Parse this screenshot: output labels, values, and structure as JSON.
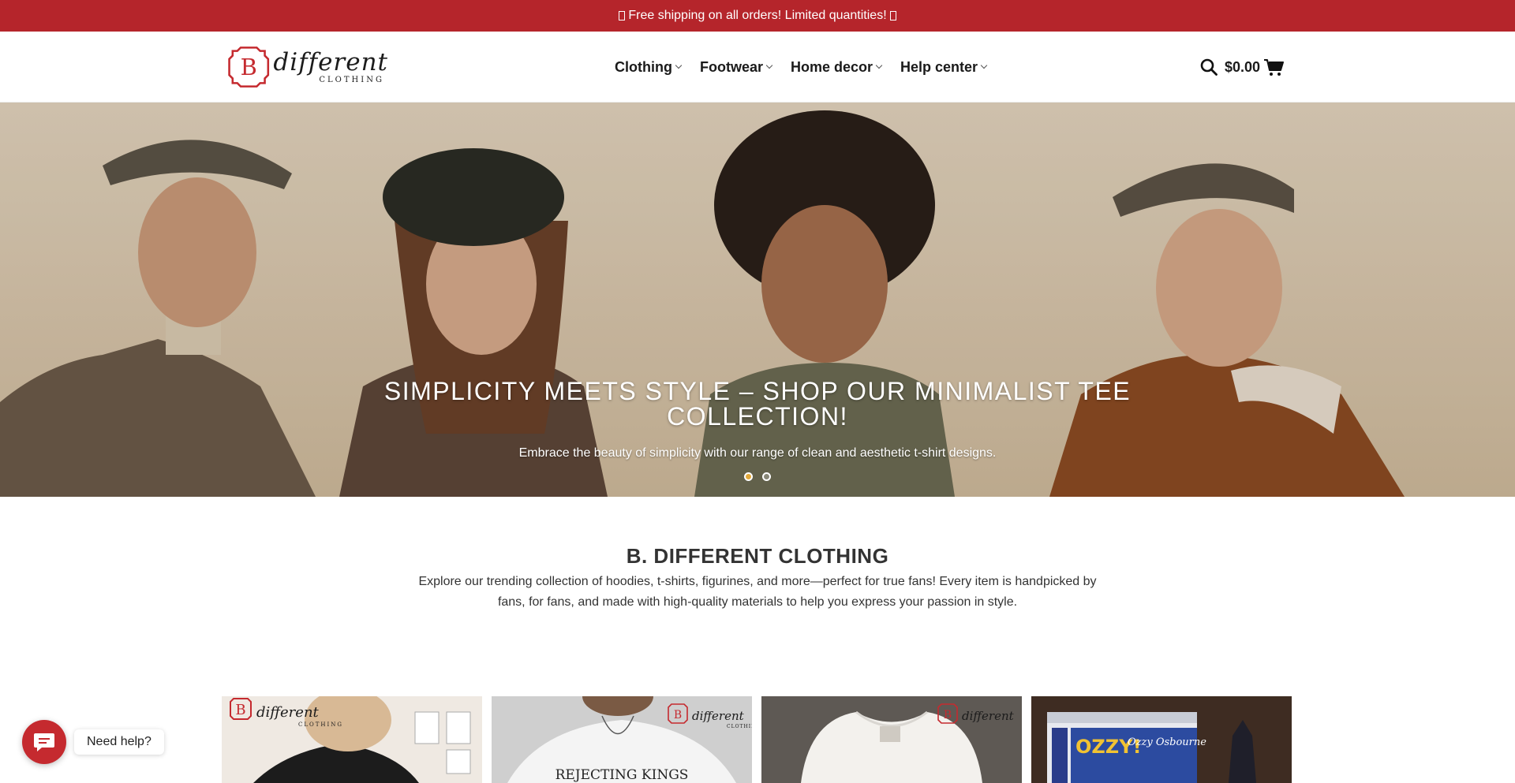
{
  "announcement": {
    "text": "Free shipping on all orders! Limited quantities!"
  },
  "header": {
    "logo": {
      "letter": "B",
      "word": "different",
      "sub": "CLOTHING"
    },
    "nav": [
      {
        "label": "Clothing"
      },
      {
        "label": "Footwear"
      },
      {
        "label": "Home decor"
      },
      {
        "label": "Help center"
      }
    ],
    "cart_total": "$0.00",
    "icons": {
      "search": "search-icon",
      "cart": "cart-icon"
    }
  },
  "hero": {
    "title": "SIMPLICITY MEETS STYLE – SHOP OUR MINIMALIST TEE COLLECTION!",
    "subtitle": "Embrace the beauty of simplicity with our range of clean and aesthetic t-shirt designs.",
    "slides": 2,
    "active_slide": 1
  },
  "intro": {
    "title": "B. DIFFERENT CLOTHING",
    "text": "Explore our trending collection of hoodies, t-shirts, figurines, and more—perfect for true fans! Every item is handpicked by fans, for fans, and made with high-quality materials to help you express your passion in style."
  },
  "products": {
    "card2_text": "REJECTING KINGS",
    "card4_text_1": "OZZY!",
    "card4_text_2": "Ozzy Osbourne"
  },
  "chat": {
    "label": "Need help?"
  },
  "colors": {
    "brand_red": "#b5252b",
    "chat_red": "#c52a2f",
    "active_dot": "#e1a93b"
  }
}
